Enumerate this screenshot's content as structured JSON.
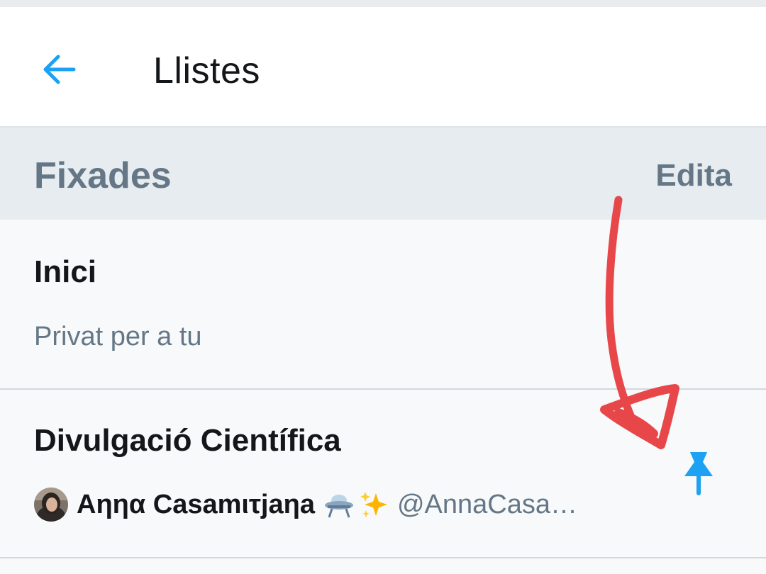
{
  "header": {
    "title": "Llistes",
    "back_icon": "arrow-left-icon",
    "accent": "#1da1f2"
  },
  "section": {
    "title": "Fixades",
    "edit_label": "Edita"
  },
  "lists": [
    {
      "name": "Inici",
      "subtitle": "Privat per a tu"
    },
    {
      "name": "Divulgació Científica",
      "owner_name": "Αηηα Casamιτjaηa",
      "owner_handle": "@AnnaCasa…",
      "owner_emojis": [
        "ufo-icon",
        "sparkles-icon"
      ],
      "pin_icon": "pin-icon",
      "pinned": true
    }
  ],
  "annotation": {
    "color": "#e8474a",
    "shape": "hand-drawn-arrow"
  }
}
